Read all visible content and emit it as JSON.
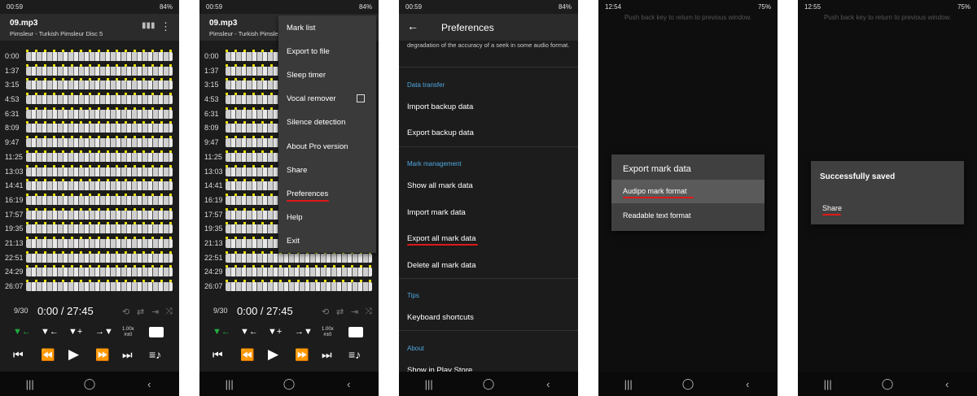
{
  "colors": {
    "accent": "#4fa8e0",
    "marker": "#e8e000",
    "underline": "#e01818",
    "play_mark": "#20b040"
  },
  "icons": {
    "eq": "equalizer-icon",
    "more": "more-vert-icon",
    "back": "arrow-back-icon",
    "folder": "folder-icon"
  },
  "status": {
    "p1": {
      "time": "00:59",
      "battery": "84%"
    },
    "p2": {
      "time": "00:59",
      "battery": "84%"
    },
    "p3": {
      "time": "00:59",
      "battery": "84%"
    },
    "p4": {
      "time": "12:54",
      "battery": "75%"
    },
    "p5": {
      "time": "12:55",
      "battery": "75%"
    }
  },
  "player": {
    "file": "09.mp3",
    "subtitle": "Pimsleur - Turkish Pimsleur Disc 5",
    "times": [
      "0:00",
      "1:37",
      "3:15",
      "4:53",
      "6:31",
      "8:09",
      "9:47",
      "11:25",
      "13:03",
      "14:41",
      "16:19",
      "17:57",
      "19:35",
      "21:13",
      "22:51",
      "24:29",
      "26:07"
    ],
    "counter": "9/30",
    "position": "0:00 / 27:45",
    "speed": "1.00x",
    "pitch": "#±0"
  },
  "menu": {
    "items": [
      "Mark list",
      "Export to file",
      "Sleep timer",
      "Vocal remover",
      "Silence detection",
      "About Pro version",
      "Share",
      "Preferences",
      "Help",
      "Exit"
    ]
  },
  "prefs": {
    "title": "Preferences",
    "prev_text": "degradation of the accuracy of a seek in some audio format.",
    "sections": {
      "data_transfer": "Data transfer",
      "mark_management": "Mark management",
      "tips": "Tips",
      "about": "About"
    },
    "items": {
      "import_backup": "Import backup data",
      "export_backup": "Export backup data",
      "show_all": "Show all mark data",
      "import_mark": "Import mark data",
      "export_all": "Export all mark data",
      "delete_all": "Delete all mark data",
      "keyboard": "Keyboard shortcuts",
      "play_store": "Show in Play Store"
    }
  },
  "export_dialog": {
    "hint": "Push back key to return to previous window.",
    "title": "Export mark data",
    "opt1": "Audipo mark format",
    "opt2": "Readable text format"
  },
  "saved_dialog": {
    "hint": "Push back key to return to previous window.",
    "title": "Successfully saved",
    "share": "Share"
  }
}
